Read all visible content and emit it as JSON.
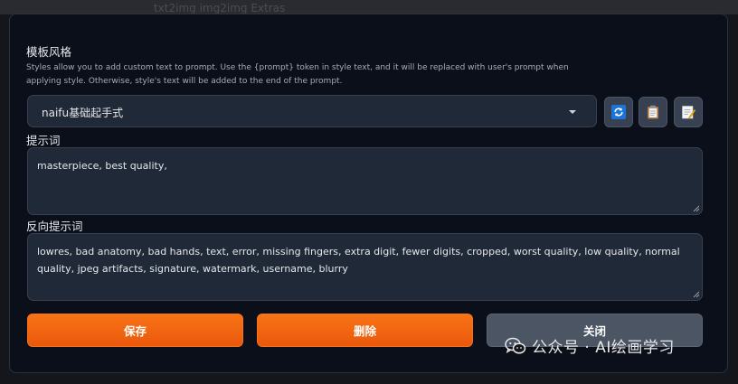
{
  "background": {
    "tab_text": "txt2img   img2img   Extras"
  },
  "styles_dialog": {
    "title": "模板风格",
    "description": "Styles allow you to add custom text to prompt. Use the {prompt} token in style text, and it will be replaced with user's prompt when applying style. Otherwise, style's text will be added to the end of the prompt.",
    "selected_style": "naifu基础起手式",
    "prompt_label": "提示词",
    "prompt_value": "masterpiece, best quality,",
    "negative_label": "反向提示词",
    "negative_value": "lowres, bad anatomy, bad hands, text, error, missing fingers, extra digit, fewer digits, cropped, worst quality, low quality, normal quality, jpeg artifacts, signature, watermark, username, blurry",
    "save_label": "保存",
    "delete_label": "删除",
    "close_label": "关闭",
    "tool_icons": [
      "refresh-icon",
      "clipboard-icon",
      "notepad-icon"
    ]
  },
  "watermark": {
    "text": "公众号 · AI绘画学习"
  },
  "colors": {
    "accent": "#f97316",
    "panel": "#0b0f19",
    "field": "#1f2937",
    "refresh_blue": "#1d74d8"
  }
}
